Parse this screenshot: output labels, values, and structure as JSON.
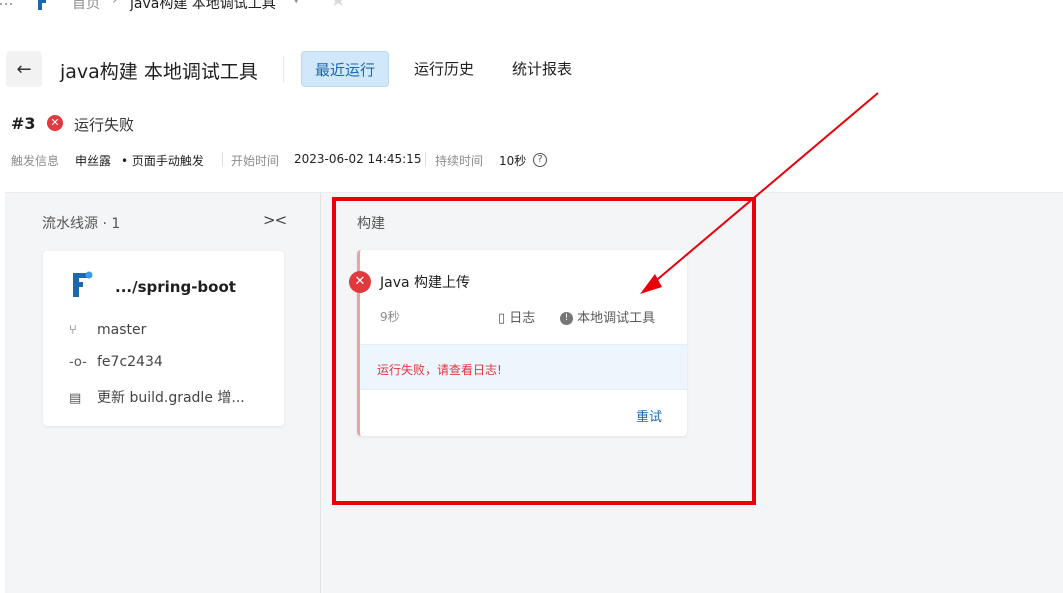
{
  "breadcrumb": {
    "home": "首页",
    "separator": "›",
    "current": "java构建 本地调试工具"
  },
  "header": {
    "title": "java构建 本地调试工具",
    "tabs": [
      {
        "label": "最近运行",
        "active": true
      },
      {
        "label": "运行历史",
        "active": false
      },
      {
        "label": "统计报表",
        "active": false
      }
    ]
  },
  "run": {
    "number": "#3",
    "status": "运行失败",
    "trigger_label": "触发信息",
    "trigger_user": "申丝露",
    "trigger_method": "• 页面手动触发",
    "start_label": "开始时间",
    "start_time": "2023-06-02 14:45:15",
    "duration_label": "持续时间",
    "duration": "10秒"
  },
  "source": {
    "title": "流水线源 · 1",
    "repo": ".../spring-boot",
    "branch": "master",
    "commit": "fe7c2434",
    "message": "更新 build.gradle 增..."
  },
  "stage": {
    "title": "构建",
    "job": {
      "name": "Java 构建上传",
      "duration": "9秒",
      "log_label": "日志",
      "tool_label": "本地调试工具",
      "error": "运行失败，请查看日志!",
      "retry": "重试"
    }
  },
  "colors": {
    "accent": "#1b67b0",
    "active_tab_bg": "#d0e8fa",
    "error": "#e0393e",
    "annotation": "#e8000b"
  }
}
